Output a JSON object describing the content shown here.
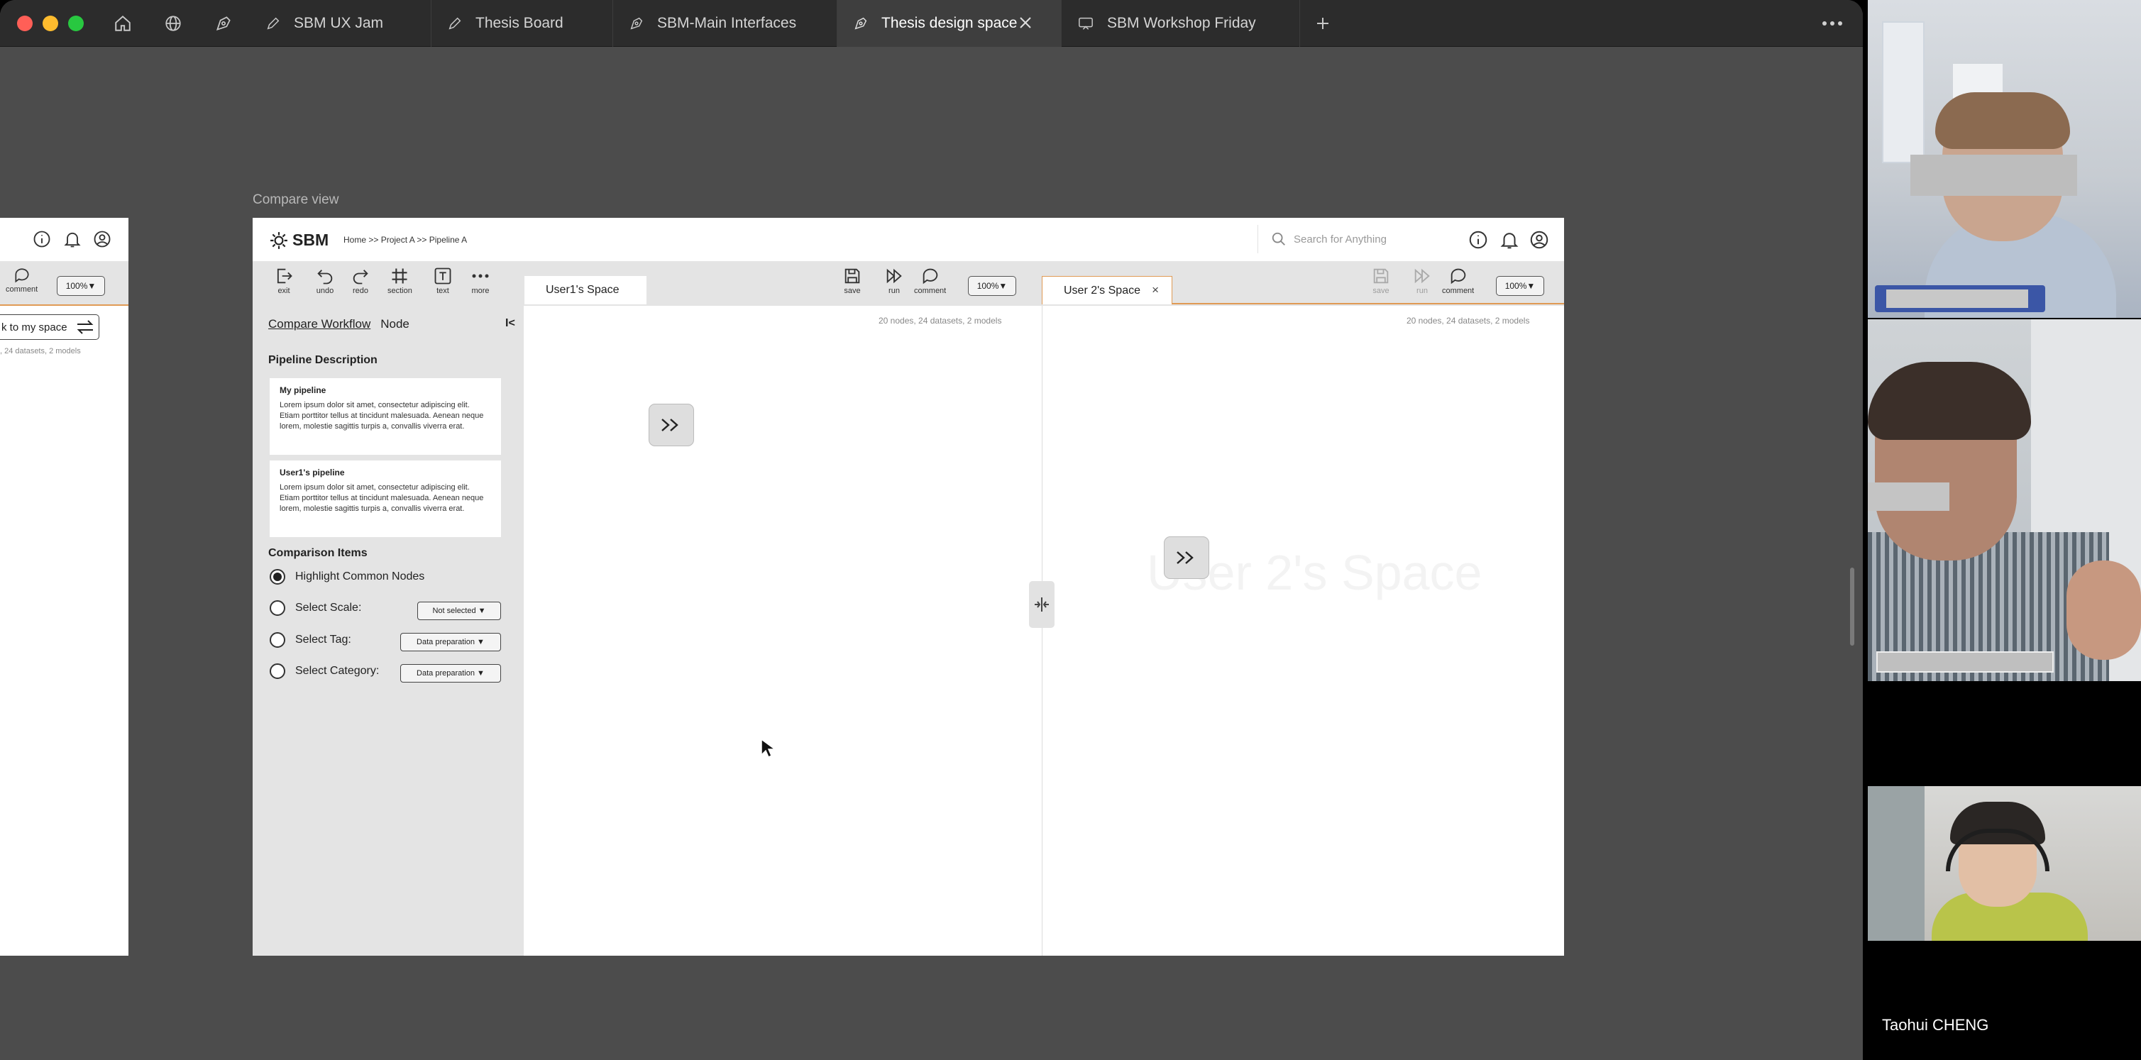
{
  "tabs": [
    {
      "label": "SBM UX Jam",
      "active": false
    },
    {
      "label": "Thesis Board",
      "active": false
    },
    {
      "label": "SBM-Main Interfaces",
      "active": false
    },
    {
      "label": "Thesis design space",
      "active": true
    },
    {
      "label": "SBM Workshop Friday",
      "active": false
    }
  ],
  "canvas": {
    "frame_label": "Compare view"
  },
  "left_frame": {
    "tool_label": "comment",
    "zoom": "100%▼",
    "back_button": "k to my space",
    "stats": ", 24 datasets, 2 models"
  },
  "app": {
    "logo": "SBM",
    "breadcrumb": "Home >> Project A >> Pipeline A",
    "search_placeholder": "Search for Anything",
    "tools": {
      "exit": "exit",
      "undo": "undo",
      "redo": "redo",
      "section": "section",
      "text": "text",
      "more": "more"
    },
    "space1": {
      "tab": "User1's Space",
      "save": "save",
      "run": "run",
      "comment": "comment",
      "zoom": "100%▼",
      "stats": "20 nodes, 24 datasets, 2 models"
    },
    "space2": {
      "tab": "User 2's Space",
      "close": "×",
      "save": "save",
      "run": "run",
      "comment": "comment",
      "zoom": "100%▼",
      "stats": "20 nodes, 24 datasets, 2 models",
      "watermark": "User 2's Space"
    }
  },
  "sidebar": {
    "tabs": {
      "workflow": "Compare Workflow",
      "node": "Node"
    },
    "collapse": "I<",
    "pipeline_title": "Pipeline Description",
    "cards": [
      {
        "title": "My pipeline",
        "text": "Lorem ipsum dolor sit amet, consectetur adipiscing elit. Etiam porttitor tellus at tincidunt malesuada. Aenean neque lorem, molestie sagittis turpis a, convallis viverra erat."
      },
      {
        "title": "User1's pipeline",
        "text": "Lorem ipsum dolor sit amet, consectetur adipiscing elit. Etiam porttitor tellus at tincidunt malesuada. Aenean neque lorem, molestie sagittis turpis a, convallis viverra erat."
      }
    ],
    "comparison_title": "Comparison Items",
    "items": [
      {
        "label": "Highlight Common Nodes",
        "selected": true,
        "value": ""
      },
      {
        "label": "Select Scale:",
        "selected": false,
        "value": "Not selected ▼"
      },
      {
        "label": "Select Tag:",
        "selected": false,
        "value": "Data preparation ▼"
      },
      {
        "label": "Select Category:",
        "selected": false,
        "value": "Data preparation ▼"
      }
    ]
  },
  "participants": [
    {
      "name": ""
    },
    {
      "name": ""
    },
    {
      "name": "Taohui CHENG"
    }
  ],
  "colors": {
    "accent_orange": "#e09a55",
    "window_bg": "#4c4c4c",
    "tabbar_bg": "#2c2c2c",
    "toolbar_bg": "#e4e4e4"
  },
  "icons": [
    "home-icon",
    "globe-icon",
    "figma-pen-icon",
    "pen-icon",
    "whiteboard-icon",
    "plus-icon",
    "more-icon",
    "search-icon",
    "info-icon",
    "bell-icon",
    "user-icon",
    "node-arrow-icon",
    "split-handle-icon",
    "cursor-icon"
  ]
}
